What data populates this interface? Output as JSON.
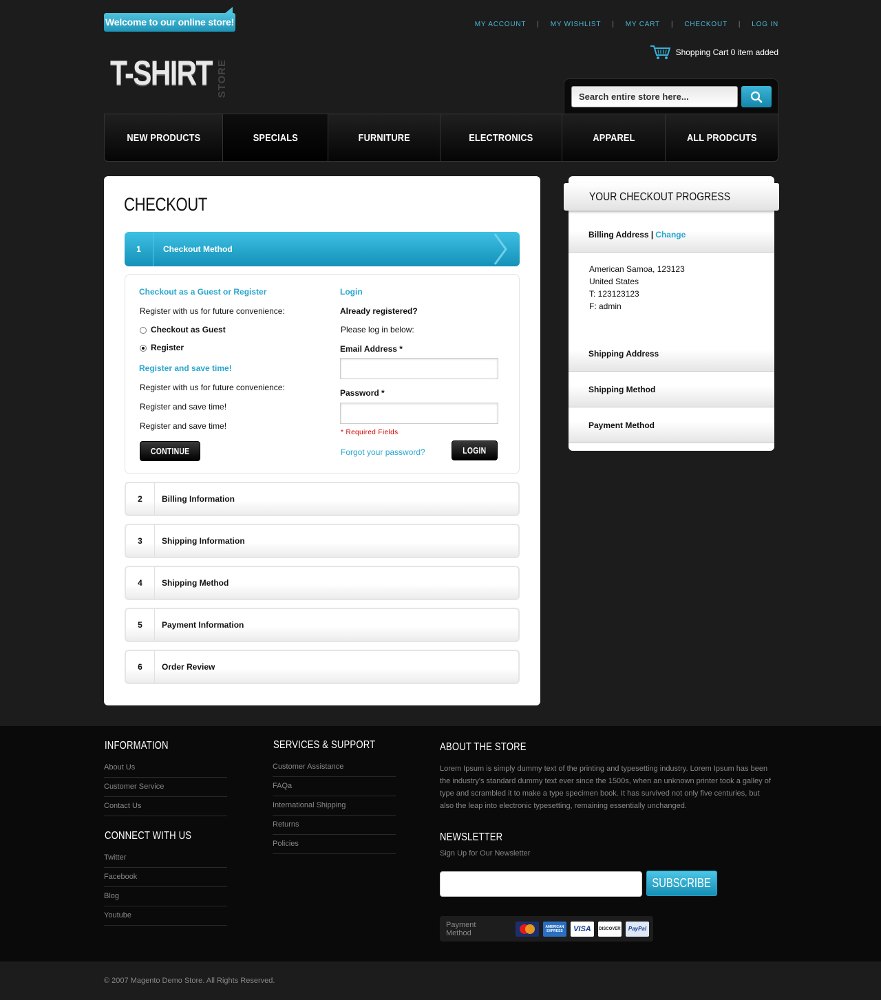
{
  "header": {
    "welcome": "Welcome to our online store!",
    "top_links": [
      "MY ACCOUNT",
      "MY WISHLIST",
      "MY CART",
      "CHECKOUT",
      "LOG IN"
    ],
    "logo_main": "T-SHIRT",
    "logo_sub": "STORE",
    "cart_text": "Shopping Cart 0 item added",
    "search_placeholder": "Search entire store here..."
  },
  "nav": {
    "items": [
      "NEW PRODUCTS",
      "SPECIALS",
      "FURNITURE",
      "ELECTRONICS",
      "APPAREL",
      "ALL PRODCUTS"
    ],
    "active": "SPECIALS"
  },
  "checkout": {
    "title": "CHECKOUT",
    "steps": [
      {
        "num": "1",
        "label": "Checkout Method"
      },
      {
        "num": "2",
        "label": "Billing Information"
      },
      {
        "num": "3",
        "label": "Shipping Information"
      },
      {
        "num": "4",
        "label": "Shipping Method"
      },
      {
        "num": "5",
        "label": "Payment Information"
      },
      {
        "num": "6",
        "label": "Order Review"
      }
    ],
    "guest": {
      "title": "Checkout as a Guest or Register",
      "intro": "Register with us for future convenience:",
      "option_guest": "Checkout as Guest",
      "option_register": "Register",
      "selected": "Register",
      "save_title": "Register and save time!",
      "line1": "Register with us for future convenience:",
      "line2": "Register and save time!",
      "line3": "Register and save time!",
      "continue_label": "CONTINUE"
    },
    "login": {
      "title": "Login",
      "already": "Already registered?",
      "prompt": "Please log in below:",
      "email_label": "Email Address",
      "password_label": "Password",
      "required_mark": "*",
      "required_note": "* Required Fields",
      "forgot": "Forgot your password?",
      "login_label": "LOGIN"
    }
  },
  "progress": {
    "title": "YOUR CHECKOUT PROGRESS",
    "billing_label": "Billing Address",
    "separator": "|",
    "change": "Change",
    "address": [
      "American Samoa, 123123",
      "United States",
      "T: 123123123",
      "F: admin"
    ],
    "shipping_address": "Shipping Address",
    "shipping_method": "Shipping Method",
    "payment_method": "Payment Method"
  },
  "footer": {
    "information": {
      "title": "INFORMATION",
      "links": [
        "About Us",
        "Customer Service",
        "Contact Us"
      ]
    },
    "connect": {
      "title": "CONNECT WITH US",
      "links": [
        "Twitter",
        "Facebook",
        "Blog",
        "Youtube"
      ]
    },
    "services": {
      "title": "SERVICES & SUPPORT",
      "links": [
        "Customer Assistance",
        "FAQa",
        "International Shipping",
        "Returns",
        "Policies"
      ]
    },
    "about": {
      "title": "ABOUT THE STORE",
      "text": "Lorem Ipsum is simply dummy text of the printing and typesetting industry. Lorem Ipsum has been the industry's standard dummy text ever since the 1500s, when an unknown printer took a galley of type and scrambled it to make a type specimen book. It has survived not only five centuries, but also the leap into electronic typesetting, remaining essentially unchanged."
    },
    "newsletter": {
      "title": "NEWSLETTER",
      "subtitle": "Sign Up for Our Newsletter",
      "subscribe_label": "SUBSCRIBE"
    },
    "payment": {
      "label": "Payment Method",
      "cards": [
        "MasterCard",
        "AMERICAN EXPRESS",
        "VISA",
        "DISCOVER",
        "PayPal"
      ]
    },
    "copyright": "© 2007 Magento Demo Store. All Rights Reserved."
  },
  "colors": {
    "accent": "#2aa7cf",
    "background": "#1c1c1c",
    "footer_bg": "#0a0a0a"
  }
}
